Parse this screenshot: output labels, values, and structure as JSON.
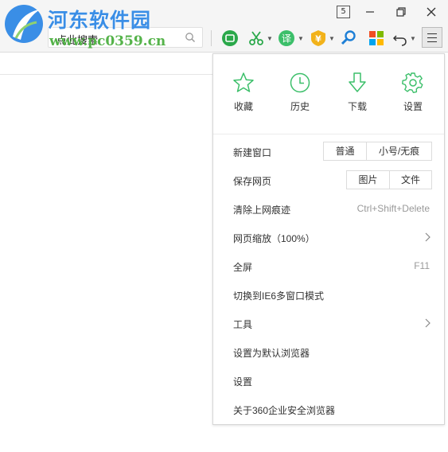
{
  "watermark": {
    "title": "河东软件园",
    "url": "www.pc0359.cn"
  },
  "titlebar": {
    "tab_count": "5"
  },
  "toolbar": {
    "search_placeholder": "点此搜索"
  },
  "menu": {
    "quick": [
      {
        "label": "收藏",
        "icon": "star-icon"
      },
      {
        "label": "历史",
        "icon": "clock-icon"
      },
      {
        "label": "下载",
        "icon": "download-icon"
      },
      {
        "label": "设置",
        "icon": "gear-icon"
      }
    ],
    "items": [
      {
        "label": "新建窗口",
        "options": [
          "普通",
          "小号/无痕"
        ]
      },
      {
        "label": "保存网页",
        "options": [
          "图片",
          "文件"
        ]
      },
      {
        "label": "清除上网痕迹",
        "shortcut": "Ctrl+Shift+Delete"
      },
      {
        "label": "网页缩放（100%）",
        "submenu": true
      },
      {
        "label": "全屏",
        "shortcut": "F11"
      },
      {
        "label": "切换到IE6多窗口模式"
      },
      {
        "label": "工具",
        "submenu": true
      },
      {
        "label": "设置为默认浏览器"
      },
      {
        "label": "设置"
      },
      {
        "label": "关于360企业安全浏览器"
      }
    ]
  },
  "colors": {
    "accent_green": "#3cbf6a",
    "watermark_blue": "#3a8ee6",
    "watermark_green": "#55b34a"
  }
}
